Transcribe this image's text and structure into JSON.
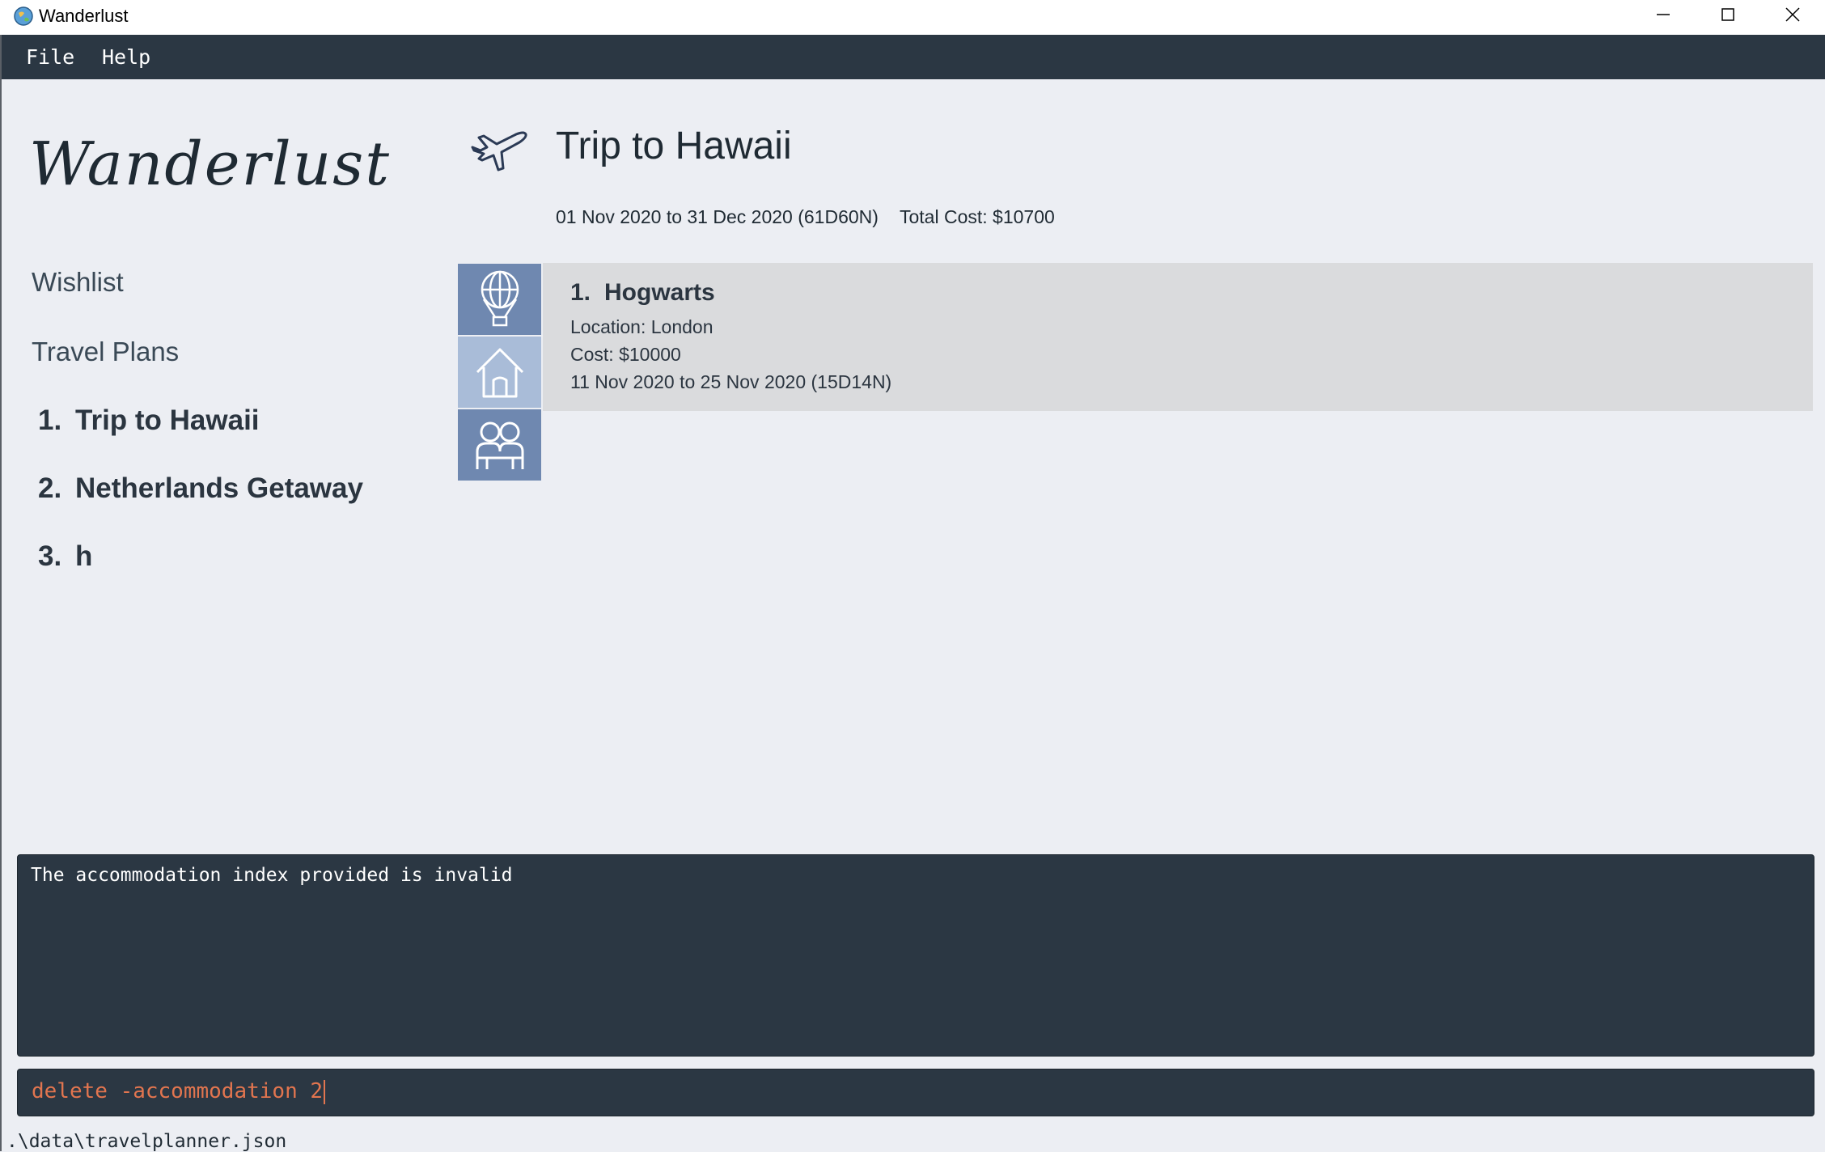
{
  "window": {
    "title": "Wanderlust",
    "controls": [
      "minimize-icon",
      "maximize-icon",
      "close-icon"
    ]
  },
  "menu": {
    "items": [
      {
        "label": "File"
      },
      {
        "label": "Help"
      }
    ]
  },
  "sidebar": {
    "logo": "Wanderlust",
    "nav": [
      {
        "label": "Wishlist"
      },
      {
        "label": "Travel Plans"
      }
    ],
    "travel_plans": [
      {
        "index": "1.",
        "name": "Trip to Hawaii"
      },
      {
        "index": "2.",
        "name": "Netherlands Getaway"
      },
      {
        "index": "3.",
        "name": "h"
      }
    ]
  },
  "main": {
    "icon": "airplane-icon",
    "title": "Trip to Hawaii",
    "dates": "01 Nov 2020 to 31 Dec 2020 (61D60N)",
    "total_cost": "Total Cost: $10700",
    "tabs": [
      {
        "name": "activity",
        "icon": "hot-air-balloon-icon"
      },
      {
        "name": "accommodation",
        "icon": "house-icon",
        "active": true
      },
      {
        "name": "friends",
        "icon": "people-icon"
      }
    ],
    "items": [
      {
        "index": "1.",
        "name": "Hogwarts",
        "location": "Location: London",
        "cost": "Cost: $10000",
        "dates": "11 Nov 2020 to 25 Nov 2020 (15D14N)"
      }
    ]
  },
  "result": {
    "text": "The accommodation index provided is invalid"
  },
  "command": {
    "value": "delete -accommodation 2"
  },
  "status_bar": {
    "path": ".\\data\\travelplanner.json"
  },
  "colors": {
    "menubar": "#2b3743",
    "background": "#eceef3",
    "tab": "#6f88b0",
    "tab_active": "#a9bcd8",
    "command_text": "#e2754f"
  }
}
